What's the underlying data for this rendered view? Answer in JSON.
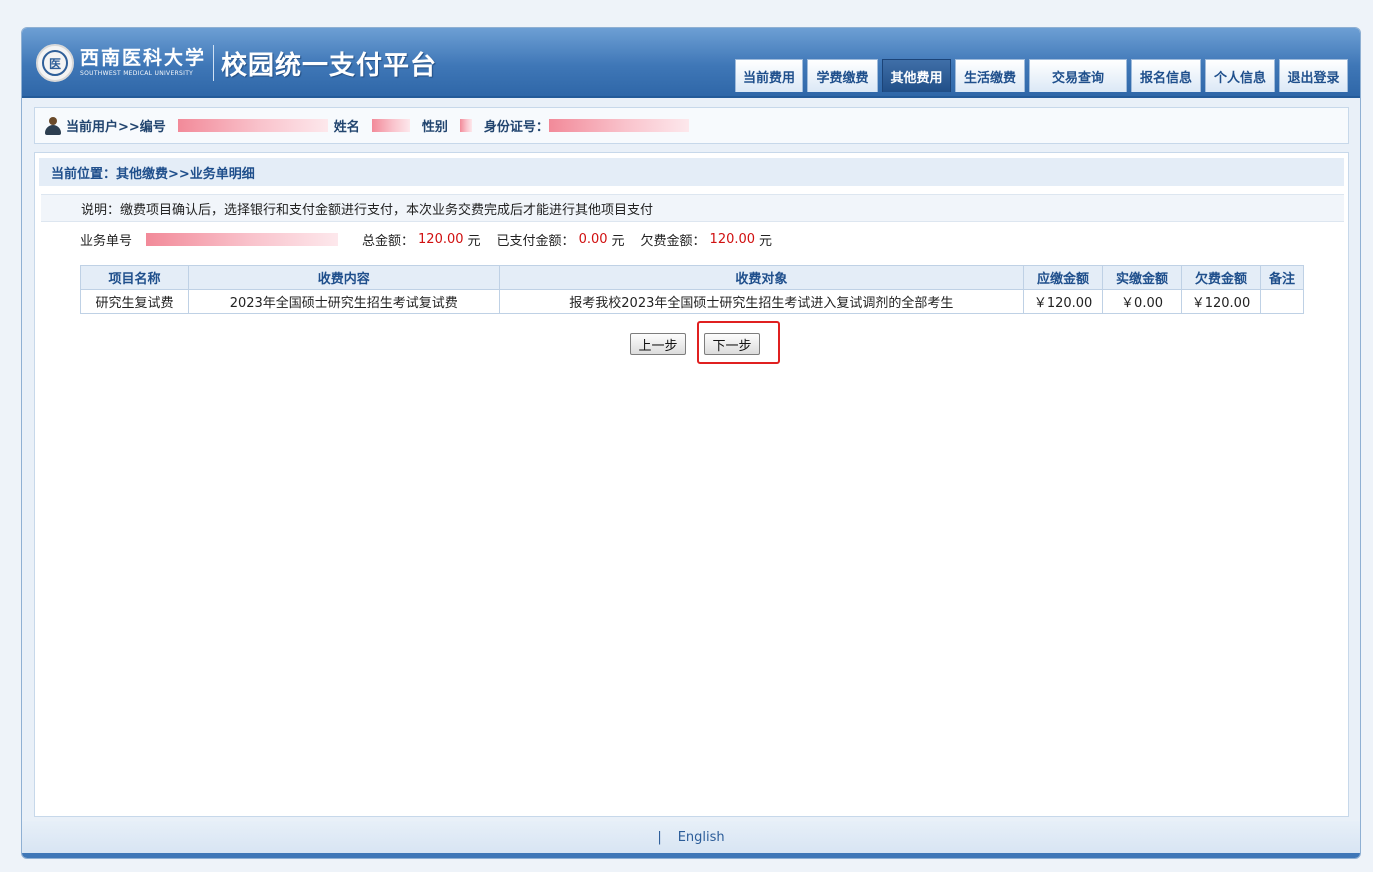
{
  "header": {
    "university_cn": "西南医科大学",
    "university_en": "SOUTHWEST MEDICAL UNIVERSITY",
    "seal_char": "医",
    "platform_title": "校园统一支付平台",
    "nav": [
      {
        "label": "当前费用",
        "active": false
      },
      {
        "label": "学费缴费",
        "active": false
      },
      {
        "label": "其他费用",
        "active": true
      },
      {
        "label": "生活缴费",
        "active": false
      },
      {
        "label": "交易查询",
        "active": false
      },
      {
        "label": "报名信息",
        "active": false
      },
      {
        "label": "个人信息",
        "active": false
      },
      {
        "label": "退出登录",
        "active": false
      }
    ]
  },
  "userbar": {
    "current_user": "当前用户>>编号",
    "name_label": "姓名",
    "gender_label": "性别",
    "id_label": "身份证号："
  },
  "breadcrumb": "当前位置：其他缴费>>业务单明细",
  "note": "说明：缴费项目确认后，选择银行和支付金额进行支付，本次业务交费完成后才能进行其他项目支付",
  "summary": {
    "order_label": "业务单号",
    "total_label": "总金额：",
    "total_value": "120.00",
    "paid_label": "已支付金额：",
    "paid_value": "0.00",
    "owed_label": "欠费金额：",
    "owed_value": "120.00",
    "unit": "元"
  },
  "table": {
    "headers": [
      "项目名称",
      "收费内容",
      "收费对象",
      "应缴金额",
      "实缴金额",
      "欠费金额",
      "备注"
    ],
    "rows": [
      [
        "研究生复试费",
        "2023年全国硕士研究生招生考试复试费",
        "报考我校2023年全国硕士研究生招生考试进入复试调剂的全部考生",
        "￥120.00",
        "￥0.00",
        "￥120.00",
        ""
      ]
    ]
  },
  "buttons": {
    "prev": "上一步",
    "next": "下一步"
  },
  "footer": {
    "separator": "|",
    "language_link": "English"
  }
}
